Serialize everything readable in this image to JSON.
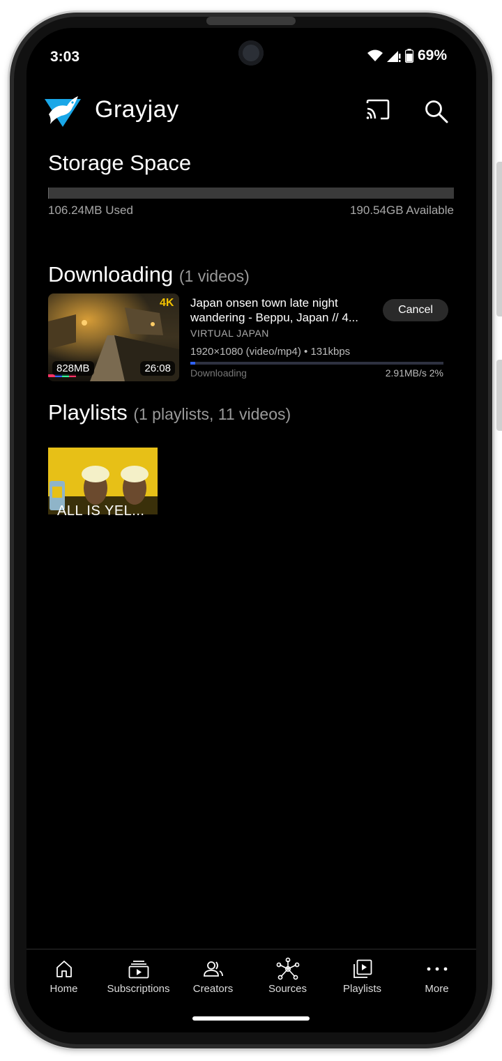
{
  "status": {
    "time": "3:03",
    "battery": "69%"
  },
  "app": {
    "title": "Grayjay"
  },
  "storage": {
    "title": "Storage Space",
    "used": "106.24MB Used",
    "available": "190.54GB Available",
    "used_fraction": 0.0006
  },
  "downloading": {
    "title": "Downloading",
    "count": "(1 videos)",
    "item": {
      "title": "Japan onsen town late night wandering - Beppu, Japan // 4...",
      "channel": "VIRTUAL JAPAN",
      "format": "1920×1080 (video/mp4) • 131kbps",
      "status": "Downloading",
      "speed": "2.91MB/s 2%",
      "progress_percent": 2,
      "size": "828MB",
      "duration": "26:08",
      "cancel_label": "Cancel"
    }
  },
  "playlists": {
    "title": "Playlists",
    "count": "(1 playlists, 11 videos)",
    "items": [
      {
        "title": "ALL IS YEL..."
      }
    ]
  },
  "nav": [
    {
      "label": "Home",
      "icon": "home-icon"
    },
    {
      "label": "Subscriptions",
      "icon": "subscriptions-icon"
    },
    {
      "label": "Creators",
      "icon": "creators-icon"
    },
    {
      "label": "Sources",
      "icon": "sources-icon"
    },
    {
      "label": "Playlists",
      "icon": "playlists-icon"
    },
    {
      "label": "More",
      "icon": "more-icon"
    }
  ],
  "colors": {
    "progress": "#2f62ff",
    "background": "#000000",
    "logo": "#19a7e8"
  }
}
